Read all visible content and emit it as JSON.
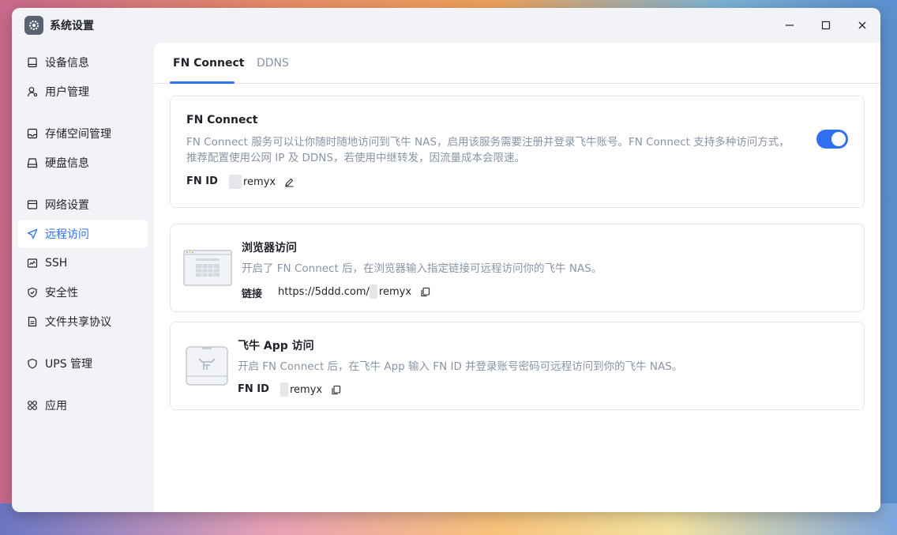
{
  "window": {
    "title": "系统设置"
  },
  "sidebar": {
    "items": [
      {
        "label": "设备信息",
        "icon": "monitor-icon"
      },
      {
        "label": "用户管理",
        "icon": "user-icon"
      },
      {
        "label": "存储空间管理",
        "icon": "storage-icon"
      },
      {
        "label": "硬盘信息",
        "icon": "disk-icon"
      },
      {
        "label": "网络设置",
        "icon": "network-icon"
      },
      {
        "label": "远程访问",
        "icon": "send-icon",
        "active": true
      },
      {
        "label": "SSH",
        "icon": "terminal-icon"
      },
      {
        "label": "安全性",
        "icon": "shield-check-icon"
      },
      {
        "label": "文件共享协议",
        "icon": "document-icon"
      },
      {
        "label": "UPS 管理",
        "icon": "shield-icon"
      },
      {
        "label": "应用",
        "icon": "apps-icon"
      }
    ]
  },
  "tabs": [
    {
      "label": "FN Connect",
      "active": true
    },
    {
      "label": "DDNS",
      "active": false
    }
  ],
  "fn_connect": {
    "title": "FN Connect",
    "desc_line1": "FN Connect 服务可以让你随时随地访问到飞牛 NAS，启用该服务需要注册并登录飞牛账号。FN Connect 支持多种访问方式，",
    "desc_line2": "推荐配置使用公网 IP 及 DDNS，若使用中继转发，因流量成本会限速。",
    "id_label": "FN ID",
    "id_value": "remyx",
    "enabled": true
  },
  "browser_access": {
    "title": "浏览器访问",
    "desc": "开启了 FN Connect 后，在浏览器输入指定链接可远程访问你的飞牛 NAS。",
    "link_label": "链接",
    "link_prefix": "https://5ddd.com/",
    "link_suffix": "remyx"
  },
  "app_access": {
    "title": "飞牛 App 访问",
    "desc": "开启 FN Connect 后，在飞牛 App 输入 FN ID 并登录账号密码可远程访问到你的飞牛 NAS。",
    "id_label": "FN ID",
    "id_value": "remyx"
  },
  "colors": {
    "accent": "#2f6ff0",
    "muted_text": "#8a94a6",
    "text": "#1f2329"
  }
}
